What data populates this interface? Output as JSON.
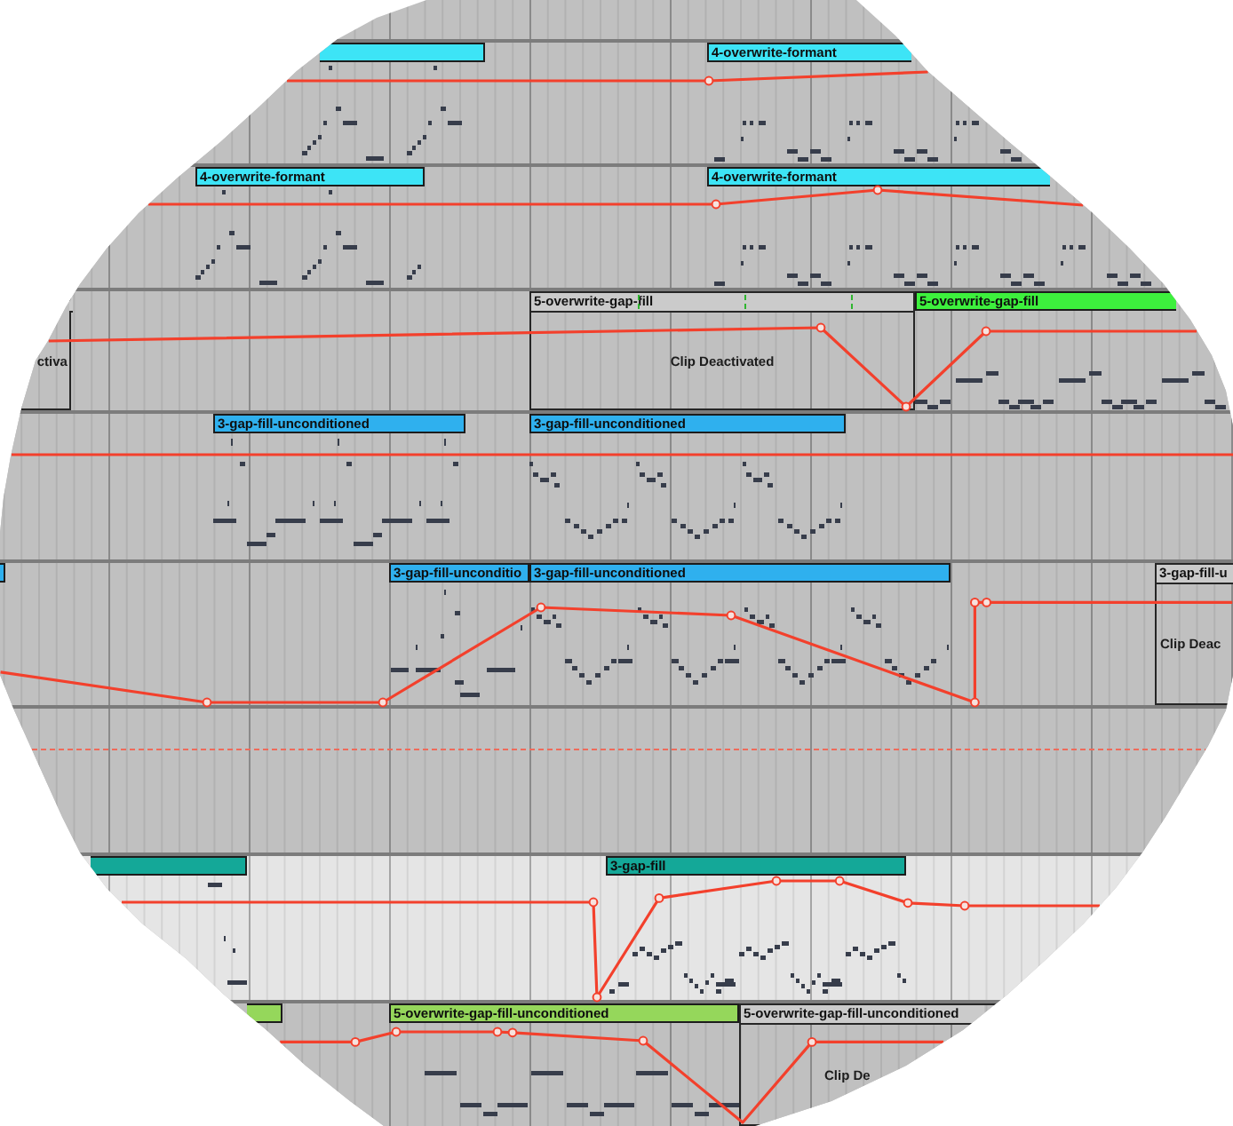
{
  "tracks": [
    {
      "kind": "track",
      "selected": false,
      "clips": [
        {
          "active": true,
          "color": "#3de4f6"
        },
        {
          "active": true,
          "color": "#3de4f6",
          "name": "4-overwrite-formant"
        }
      ]
    },
    {
      "kind": "track",
      "selected": false,
      "clips": [
        {
          "active": true,
          "color": "#3de4f6",
          "name": "4-overwrite-formant"
        },
        {
          "active": true,
          "color": "#3de4f6",
          "name": "4-overwrite-formant"
        }
      ]
    },
    {
      "kind": "track",
      "selected": false,
      "clips": [
        {
          "active": false,
          "status": "ctiva"
        },
        {
          "active": false,
          "name": "5-overwrite-gap-fill",
          "status": "Clip Deactivated"
        },
        {
          "active": true,
          "color": "#3df03d",
          "name": "5-overwrite-gap-fill"
        }
      ]
    },
    {
      "kind": "track",
      "selected": false,
      "clips": [
        {
          "active": true,
          "color": "#2fb0ee",
          "name": "3-gap-fill-unconditioned"
        },
        {
          "active": true,
          "color": "#2fb0ee",
          "name": "3-gap-fill-unconditioned"
        }
      ]
    },
    {
      "kind": "track",
      "selected": false,
      "clips": [
        {
          "active": true,
          "color": "#2fb0ee"
        },
        {
          "active": true,
          "color": "#2fb0ee",
          "name": "3-gap-fill-unconditio"
        },
        {
          "active": true,
          "color": "#2fb0ee",
          "name": "3-gap-fill-unconditioned"
        },
        {
          "active": false,
          "name": "3-gap-fill-u",
          "status": "Clip Deac"
        }
      ]
    },
    {
      "kind": "lane",
      "selected": false
    },
    {
      "kind": "track",
      "selected": true,
      "clips": [
        {
          "active": true,
          "color": "#14a898"
        },
        {
          "active": true,
          "color": "#14a898",
          "name": "3-gap-fill"
        }
      ]
    },
    {
      "kind": "track",
      "selected": false,
      "clips": [
        {
          "active": true,
          "color": "#95d75b"
        },
        {
          "active": true,
          "color": "#95d75b",
          "name": "5-overwrite-gap-fill-unconditioned"
        },
        {
          "active": false,
          "name": "5-overwrite-gap-fill-unconditioned",
          "status": "Clip De"
        }
      ]
    }
  ]
}
